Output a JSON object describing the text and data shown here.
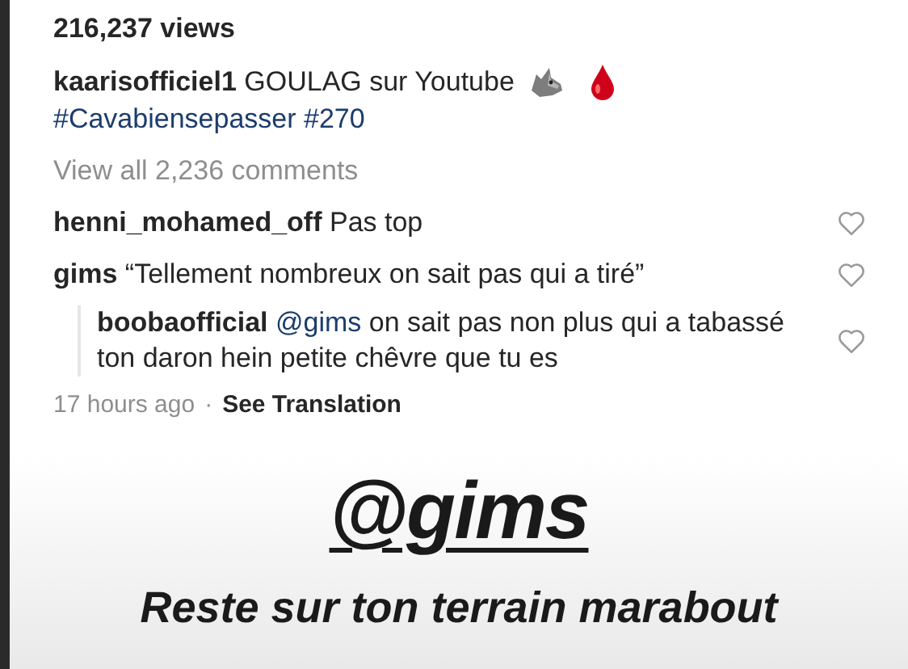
{
  "views": "216,237 views",
  "caption": {
    "user": "kaarisofficiel1",
    "text": "GOULAG sur Youtube",
    "hashtags": "#Cavabiensepasser #270"
  },
  "view_all": "View all 2,236 comments",
  "comments": [
    {
      "user": "henni_mohamed_off",
      "text": "Pas top"
    },
    {
      "user": "gims",
      "text": "“Tellement nombreux on sait pas qui a tiré”"
    }
  ],
  "reply": {
    "user": "boobaofficial",
    "mention": "@gims",
    "text": "on sait pas non plus qui a tabassé ton daron hein petite chêvre que tu es"
  },
  "meta": {
    "time": "17 hours ago",
    "separator": "·",
    "translate": "See Translation"
  },
  "overlay": {
    "tag": "@gims",
    "caption": "Reste sur ton terrain marabout"
  }
}
